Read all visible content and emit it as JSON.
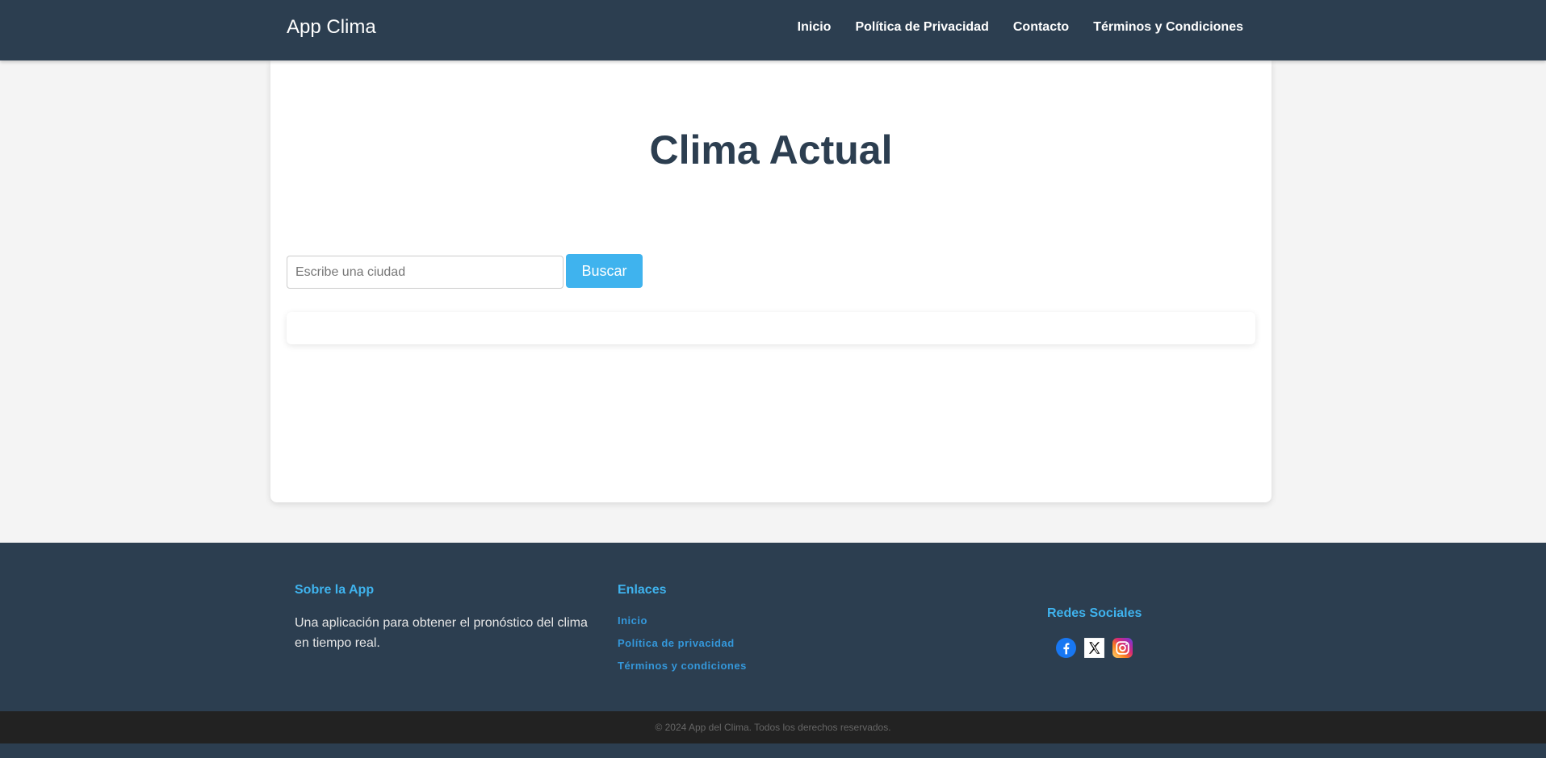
{
  "header": {
    "brand": "App Clima",
    "nav": [
      "Inicio",
      "Política de Privacidad",
      "Contacto",
      "Términos y Condiciones"
    ]
  },
  "main": {
    "title": "Clima Actual",
    "search": {
      "placeholder": "Escribe una ciudad",
      "value": "",
      "button_label": "Buscar"
    }
  },
  "footer": {
    "about": {
      "heading": "Sobre la App",
      "text": "Una aplicación para obtener el pronóstico del clima en tiempo real."
    },
    "links": {
      "heading": "Enlaces",
      "items": [
        "Inicio",
        "Política de privacidad",
        "Términos y condiciones"
      ]
    },
    "social": {
      "heading": "Redes Sociales",
      "icons": [
        "facebook-icon",
        "x-icon",
        "instagram-icon"
      ]
    },
    "copyright": "© 2024 App del Clima. Todos los derechos reservados."
  },
  "colors": {
    "navbar": "#2c3e50",
    "accent": "#3fb3ee",
    "link": "#3498db",
    "page_background": "#f4f4f4",
    "bottom_bar": "#222222"
  }
}
